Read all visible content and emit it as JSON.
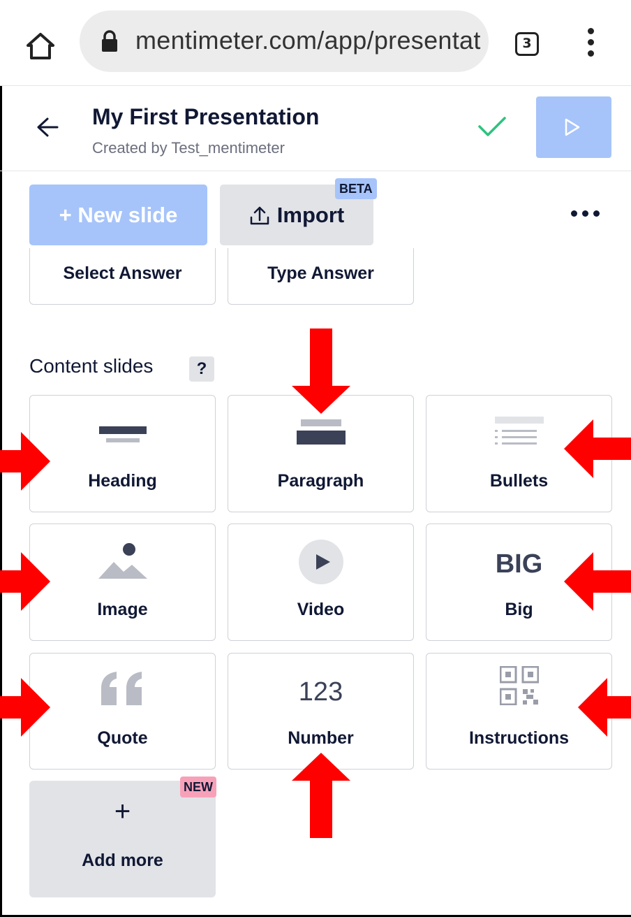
{
  "browser": {
    "url": "mentimeter.com/app/presentat",
    "tab_count": "3"
  },
  "header": {
    "title": "My First Presentation",
    "subtitle": "Created by Test_mentimeter"
  },
  "toolbar": {
    "new_slide_label": "+ New slide",
    "import_label": "Import",
    "beta_badge": "BETA"
  },
  "question_tiles": [
    {
      "label": "Select Answer"
    },
    {
      "label": "Type Answer"
    }
  ],
  "content_section": {
    "title": "Content slides",
    "help": "?"
  },
  "content_tiles": {
    "heading": "Heading",
    "paragraph": "Paragraph",
    "bullets": "Bullets",
    "image": "Image",
    "video": "Video",
    "big": "Big",
    "big_icon_text": "BIG",
    "quote": "Quote",
    "number": "Number",
    "number_icon_text": "123",
    "instructions": "Instructions"
  },
  "add_more": {
    "label": "Add more",
    "plus": "+",
    "new_badge": "NEW"
  },
  "colors": {
    "accent_blue": "#a6c4fa",
    "tile_gray": "#e2e3e7",
    "new_pink": "#f7a1b9",
    "check_green": "#2ec27e",
    "annotation_red": "#ff0000",
    "text_dark": "#101834"
  }
}
